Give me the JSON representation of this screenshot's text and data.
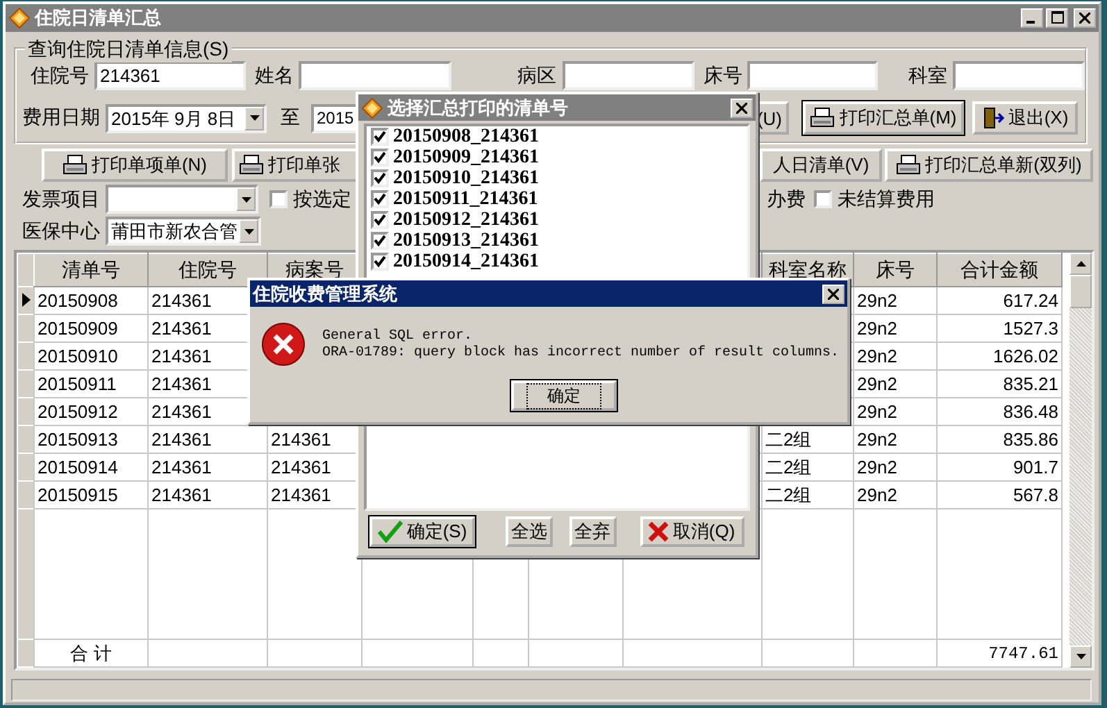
{
  "window": {
    "title": "住院日清单汇总"
  },
  "query_group": {
    "title": "查询住院日清单信息(S)",
    "fields": [
      {
        "label": "住院号",
        "value": "214361"
      },
      {
        "label": "姓名"
      },
      {
        "label": "病区"
      },
      {
        "label": "床号"
      },
      {
        "label": "科室"
      }
    ],
    "date_from": {
      "label": "费用日期",
      "value": "2015年 9月 8日"
    },
    "date_to": {
      "label": "至",
      "value": "2015"
    },
    "buttons": [
      {
        "kind": "plain",
        "label": "(U)",
        "default": false
      },
      {
        "kind": "print",
        "label": "打印汇总单(M)",
        "default": true
      },
      {
        "kind": "exit",
        "label": "退出(X)",
        "default": false
      }
    ]
  },
  "print_buttons": [
    {
      "kind": "print",
      "label": "打印单项单(N)"
    },
    {
      "kind": "print",
      "label": "打印单张"
    },
    {
      "kind": "plain",
      "label": "人日清单(V)"
    },
    {
      "kind": "print",
      "label": "打印汇总单新(双列)"
    }
  ],
  "options": [
    {
      "kind": "combo",
      "label": "发票项目"
    },
    {
      "kind": "checkbox",
      "label": "按选定",
      "checked": false
    },
    {
      "kind": "text",
      "label": "办费"
    },
    {
      "kind": "checkbox",
      "label": "未结算费用",
      "checked": false
    }
  ],
  "insurance": {
    "label": "医保中心",
    "value": "莆田市新农合管"
  },
  "grid": {
    "columns": [
      {
        "label": "清单号"
      },
      {
        "label": "住院号"
      },
      {
        "label": "病案号"
      },
      {},
      {},
      {},
      {},
      {
        "label": "科室名称"
      },
      {
        "label": "床号"
      },
      {
        "label": "合计金额"
      }
    ],
    "rows": [
      {
        "kind": "covered",
        "current": true,
        "cells": [
          "20150908",
          "214361",
          "29n2",
          "617.24"
        ]
      },
      {
        "kind": "covered",
        "current": false,
        "cells": [
          "20150909",
          "214361",
          "29n2",
          "1527.3"
        ]
      },
      {
        "kind": "covered",
        "current": false,
        "cells": [
          "20150910",
          "214361",
          "29n2",
          "1626.02"
        ]
      },
      {
        "kind": "covered",
        "current": false,
        "cells": [
          "20150911",
          "214361",
          "29n2",
          "835.21"
        ]
      },
      {
        "kind": "covered",
        "current": false,
        "cells": [
          "20150912",
          "214361",
          "29n2",
          "836.48"
        ]
      },
      {
        "kind": "open",
        "current": false,
        "cells": [
          "20150913",
          "214361",
          "214361",
          "二2组",
          "29n2",
          "835.86"
        ]
      },
      {
        "kind": "open",
        "current": false,
        "cells": [
          "20150914",
          "214361",
          "214361",
          "二2组",
          "29n2",
          "901.7"
        ]
      },
      {
        "kind": "open",
        "current": false,
        "cells": [
          "20150915",
          "214361",
          "214361",
          "二2组",
          "29n2",
          "567.8"
        ]
      }
    ],
    "footer": {
      "label": "合 计",
      "total": "7747.61"
    }
  },
  "select_dialog": {
    "title": "选择汇总打印的清单号",
    "items": [
      {
        "label": "20150908_214361",
        "checked": true
      },
      {
        "label": "20150909_214361",
        "checked": true
      },
      {
        "label": "20150910_214361",
        "checked": true
      },
      {
        "label": "20150911_214361",
        "checked": true
      },
      {
        "label": "20150912_214361",
        "checked": true
      },
      {
        "label": "20150913_214361",
        "checked": true
      },
      {
        "label": "20150914_214361",
        "checked": true
      }
    ],
    "buttons": [
      {
        "kind": "ok",
        "label": "确定(S)"
      },
      {
        "kind": "plain",
        "label": "全选"
      },
      {
        "kind": "plain",
        "label": "全弃"
      },
      {
        "kind": "cancel",
        "label": "取消(Q)"
      }
    ]
  },
  "error_dialog": {
    "title": "住院收费管理系统",
    "lines": [
      "General SQL error.",
      "ORA-01789: query block has incorrect number of result columns."
    ],
    "button": "确定"
  }
}
